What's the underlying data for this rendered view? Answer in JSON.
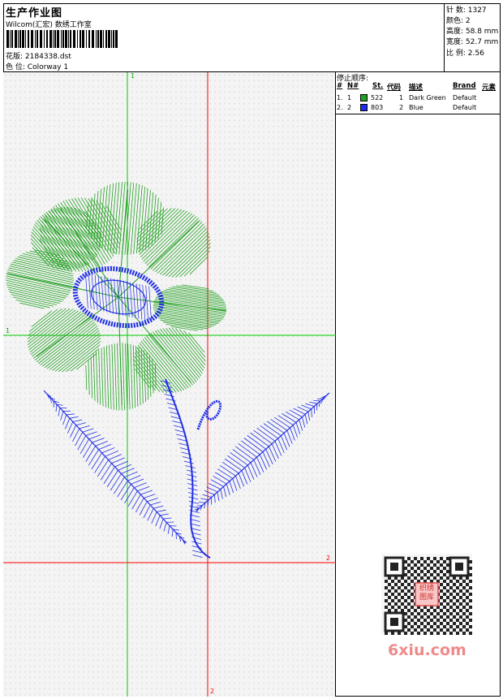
{
  "header": {
    "title": "生产作业图",
    "subtitle": "Wilcom(汇宏) 数绣工作室",
    "file_label": "花版:",
    "file_value": "2184338.dst",
    "colorway_label": "色 位:",
    "colorway_value": "Colorway 1"
  },
  "stats": {
    "stitches": "针 数: 1327",
    "colors": "颜色: 2",
    "height": "高度: 58.8 mm",
    "width": "宽度: 52.7 mm",
    "ratio": "比 例: 2.56"
  },
  "stop_sequence": {
    "title": "停止顺序:",
    "columns": [
      "#",
      "N#",
      "St.",
      "代码",
      "描述",
      "Brand",
      "元素"
    ],
    "rows": [
      {
        "idx": "1.",
        "n": "1",
        "st": "522",
        "code": "1",
        "desc": "Dark Green",
        "brand": "Default",
        "color": "#22a022"
      },
      {
        "idx": "2.",
        "n": "2",
        "st": "803",
        "code": "2",
        "desc": "Blue",
        "brand": "Default",
        "color": "#1f2ee6"
      }
    ]
  },
  "axes": {
    "green_top": "1",
    "green_left": "1",
    "red_right": "2",
    "red_bottom": "2"
  },
  "colors": {
    "green_thread": "#22a022",
    "blue_thread": "#1f2ee6",
    "guide_green": "#00cc00",
    "guide_red": "#ff0000"
  },
  "watermark": "6xiu.com",
  "qr_stamp": "织绣图库"
}
